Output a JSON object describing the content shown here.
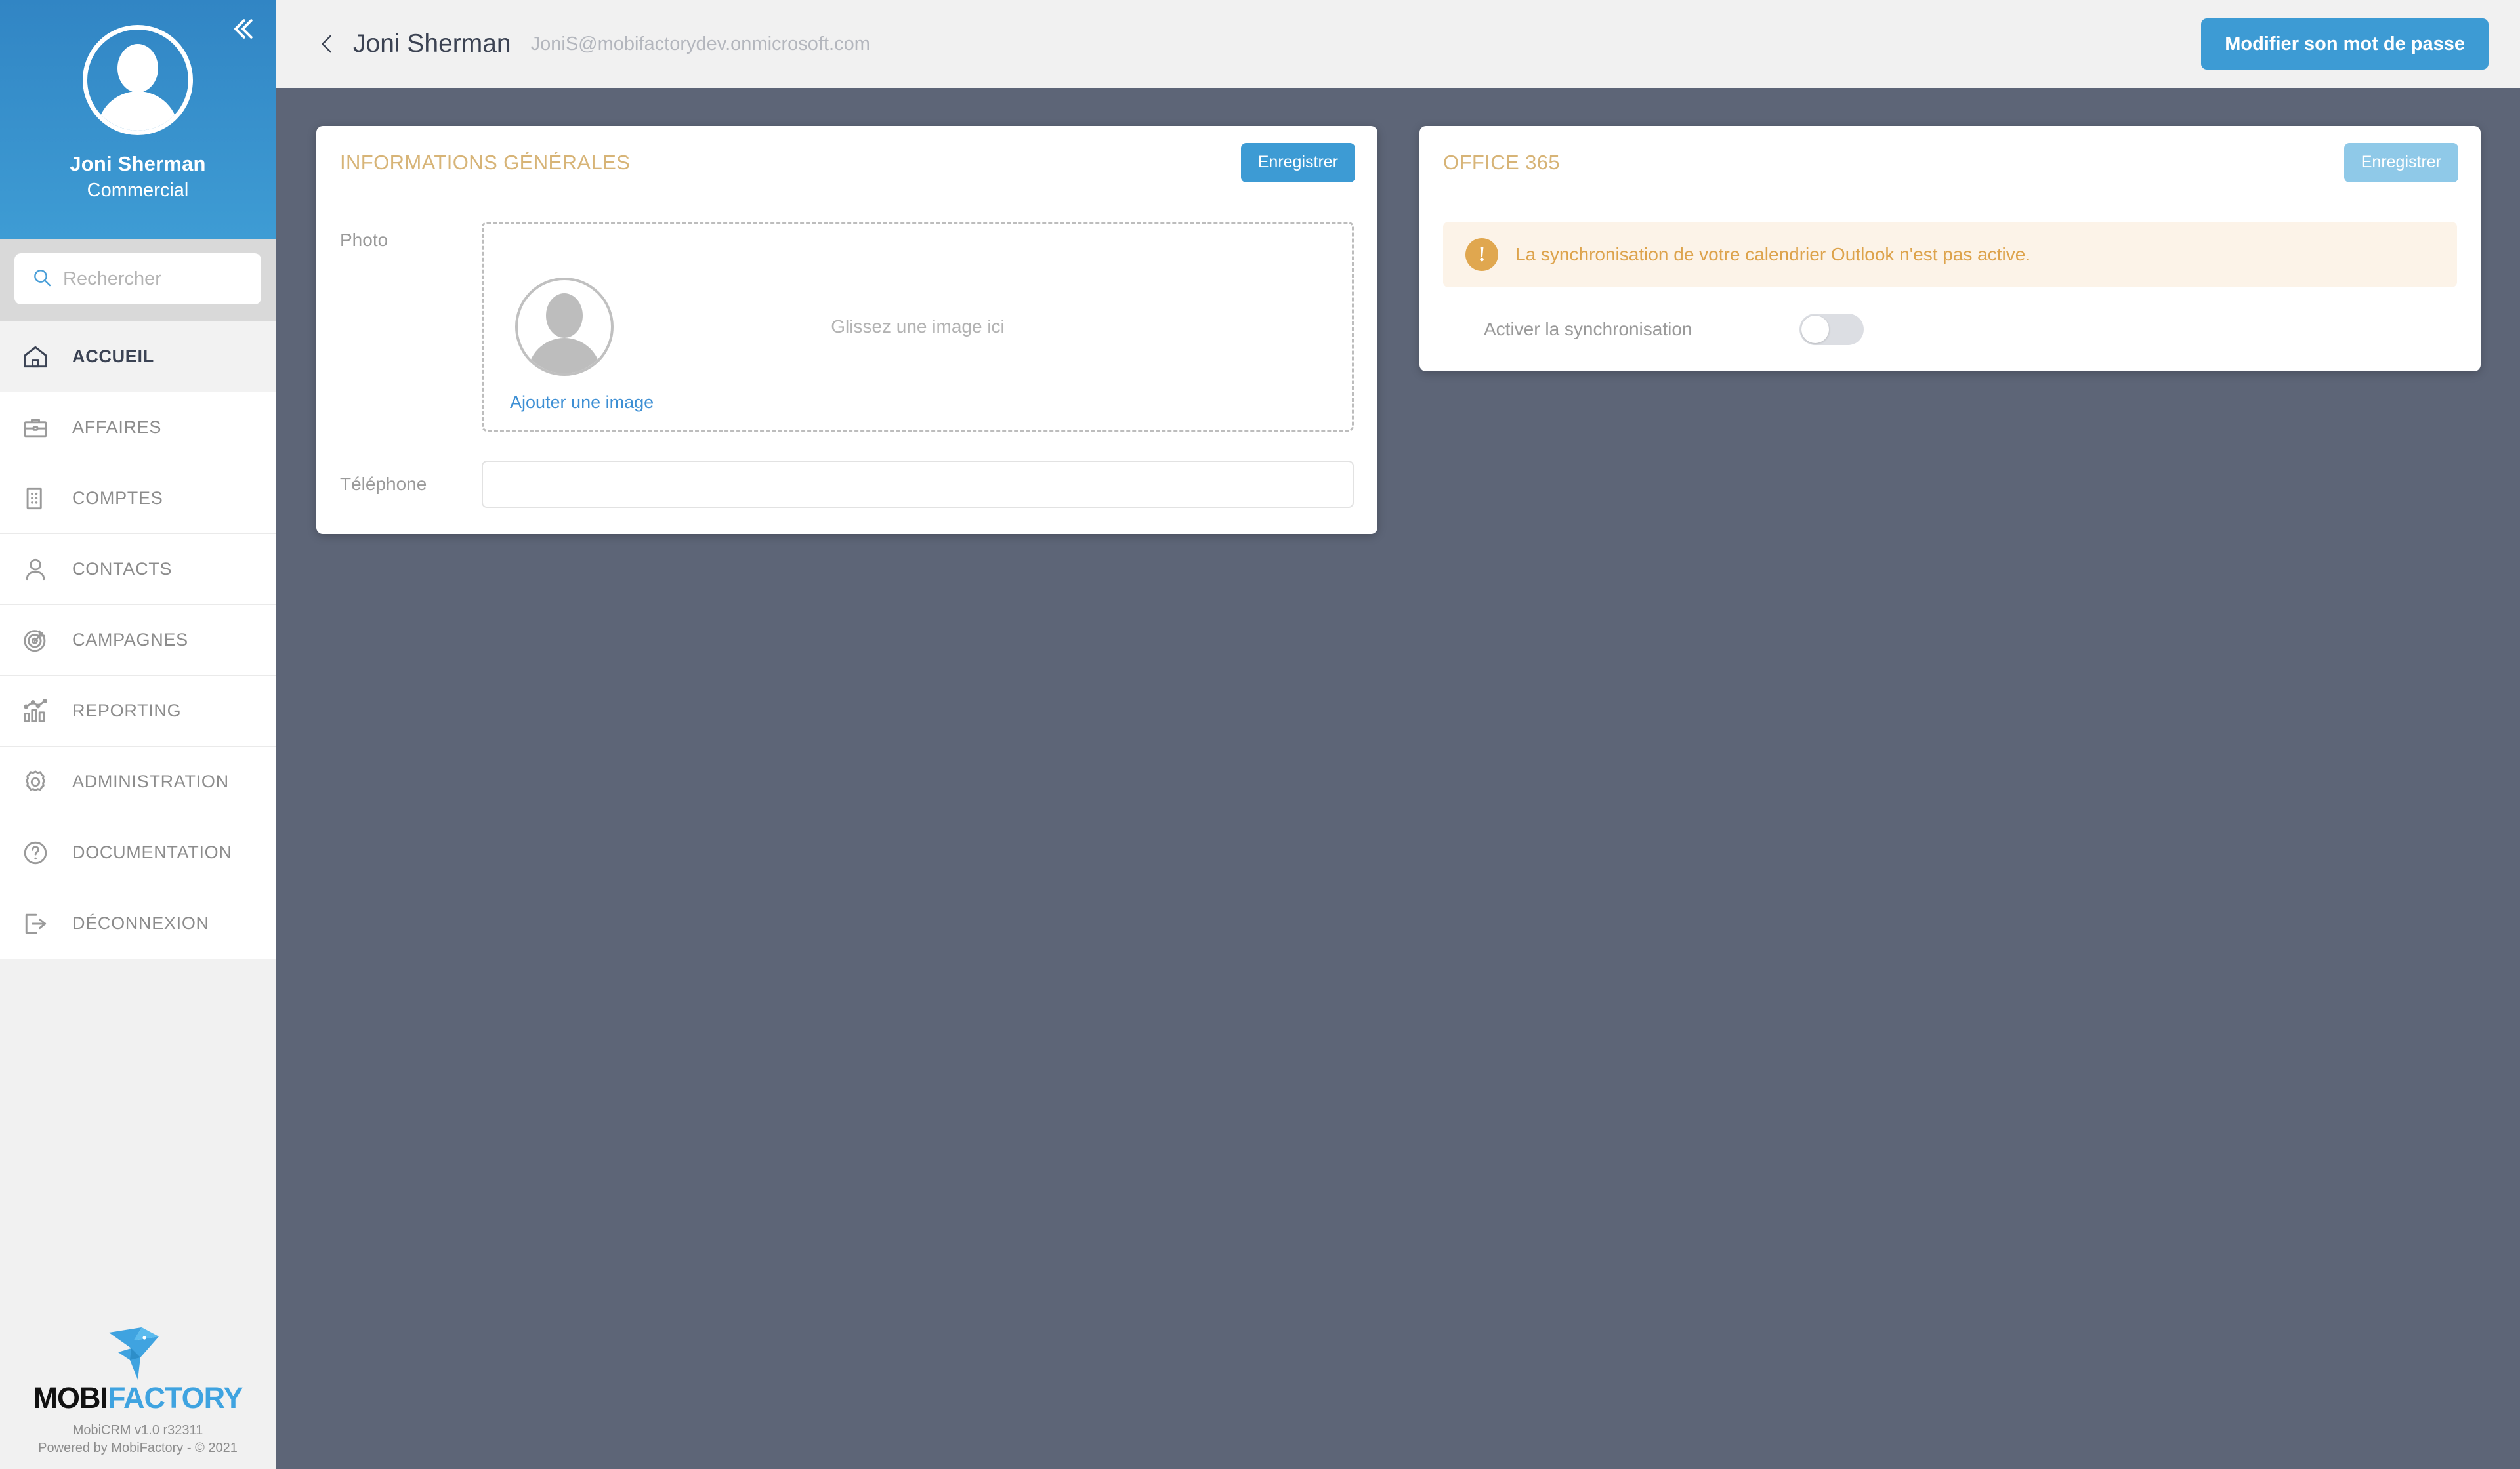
{
  "sidebar": {
    "collapse_icon": "chevron-double-left-icon",
    "profile": {
      "avatar_icon": "user-avatar-placeholder",
      "name": "Joni Sherman",
      "role": "Commercial"
    },
    "search": {
      "icon": "search-icon",
      "placeholder": "Rechercher",
      "value": ""
    },
    "items": [
      {
        "label": "ACCUEIL",
        "icon": "home-icon",
        "active": true
      },
      {
        "label": "AFFAIRES",
        "icon": "briefcase-icon",
        "active": false
      },
      {
        "label": "COMPTES",
        "icon": "building-icon",
        "active": false
      },
      {
        "label": "CONTACTS",
        "icon": "person-icon",
        "active": false
      },
      {
        "label": "CAMPAGNES",
        "icon": "target-icon",
        "active": false
      },
      {
        "label": "REPORTING",
        "icon": "bar-chart-icon",
        "active": false
      },
      {
        "label": "ADMINISTRATION",
        "icon": "gear-icon",
        "active": false
      },
      {
        "label": "DOCUMENTATION",
        "icon": "question-circle-icon",
        "active": false
      },
      {
        "label": "DÉCONNEXION",
        "icon": "logout-icon",
        "active": false
      }
    ],
    "footer": {
      "logo_icon": "mobifactory-bird-logo",
      "logo_text_dark": "MOBI",
      "logo_text_accent": "FACTORY",
      "version": "MobiCRM v1.0 r32311",
      "copyright": "Powered by MobiFactory - © 2021"
    }
  },
  "topbar": {
    "back_icon": "chevron-left-icon",
    "title": "Joni Sherman",
    "email": "JoniS@mobifactorydev.onmicrosoft.com",
    "password_button": "Modifier son mot de passe"
  },
  "general_card": {
    "title": "INFORMATIONS GÉNÉRALES",
    "save_label": "Enregistrer",
    "photo": {
      "label": "Photo",
      "avatar_icon": "user-avatar-placeholder",
      "drop_hint": "Glissez une image ici",
      "add_link": "Ajouter une image"
    },
    "phone": {
      "label": "Téléphone",
      "value": "",
      "placeholder": ""
    }
  },
  "office_card": {
    "title": "OFFICE 365",
    "save_label": "Enregistrer",
    "save_disabled": true,
    "alert": {
      "icon": "warning-exclamation-icon",
      "message": "La synchronisation de votre calendrier Outlook n'est pas active."
    },
    "sync": {
      "label": "Activer la synchronisation",
      "enabled": false
    }
  },
  "colors": {
    "accent_blue": "#3d9bd4",
    "profile_blue": "#3185c4",
    "card_title_gold": "#d7b477",
    "alert_bg": "#fcf3e8",
    "alert_text": "#dda34c",
    "alert_icon": "#e0a74f",
    "main_bg": "#5d6577",
    "sidebar_bg": "#f1f1f1",
    "link_blue": "#3d8fd4"
  }
}
